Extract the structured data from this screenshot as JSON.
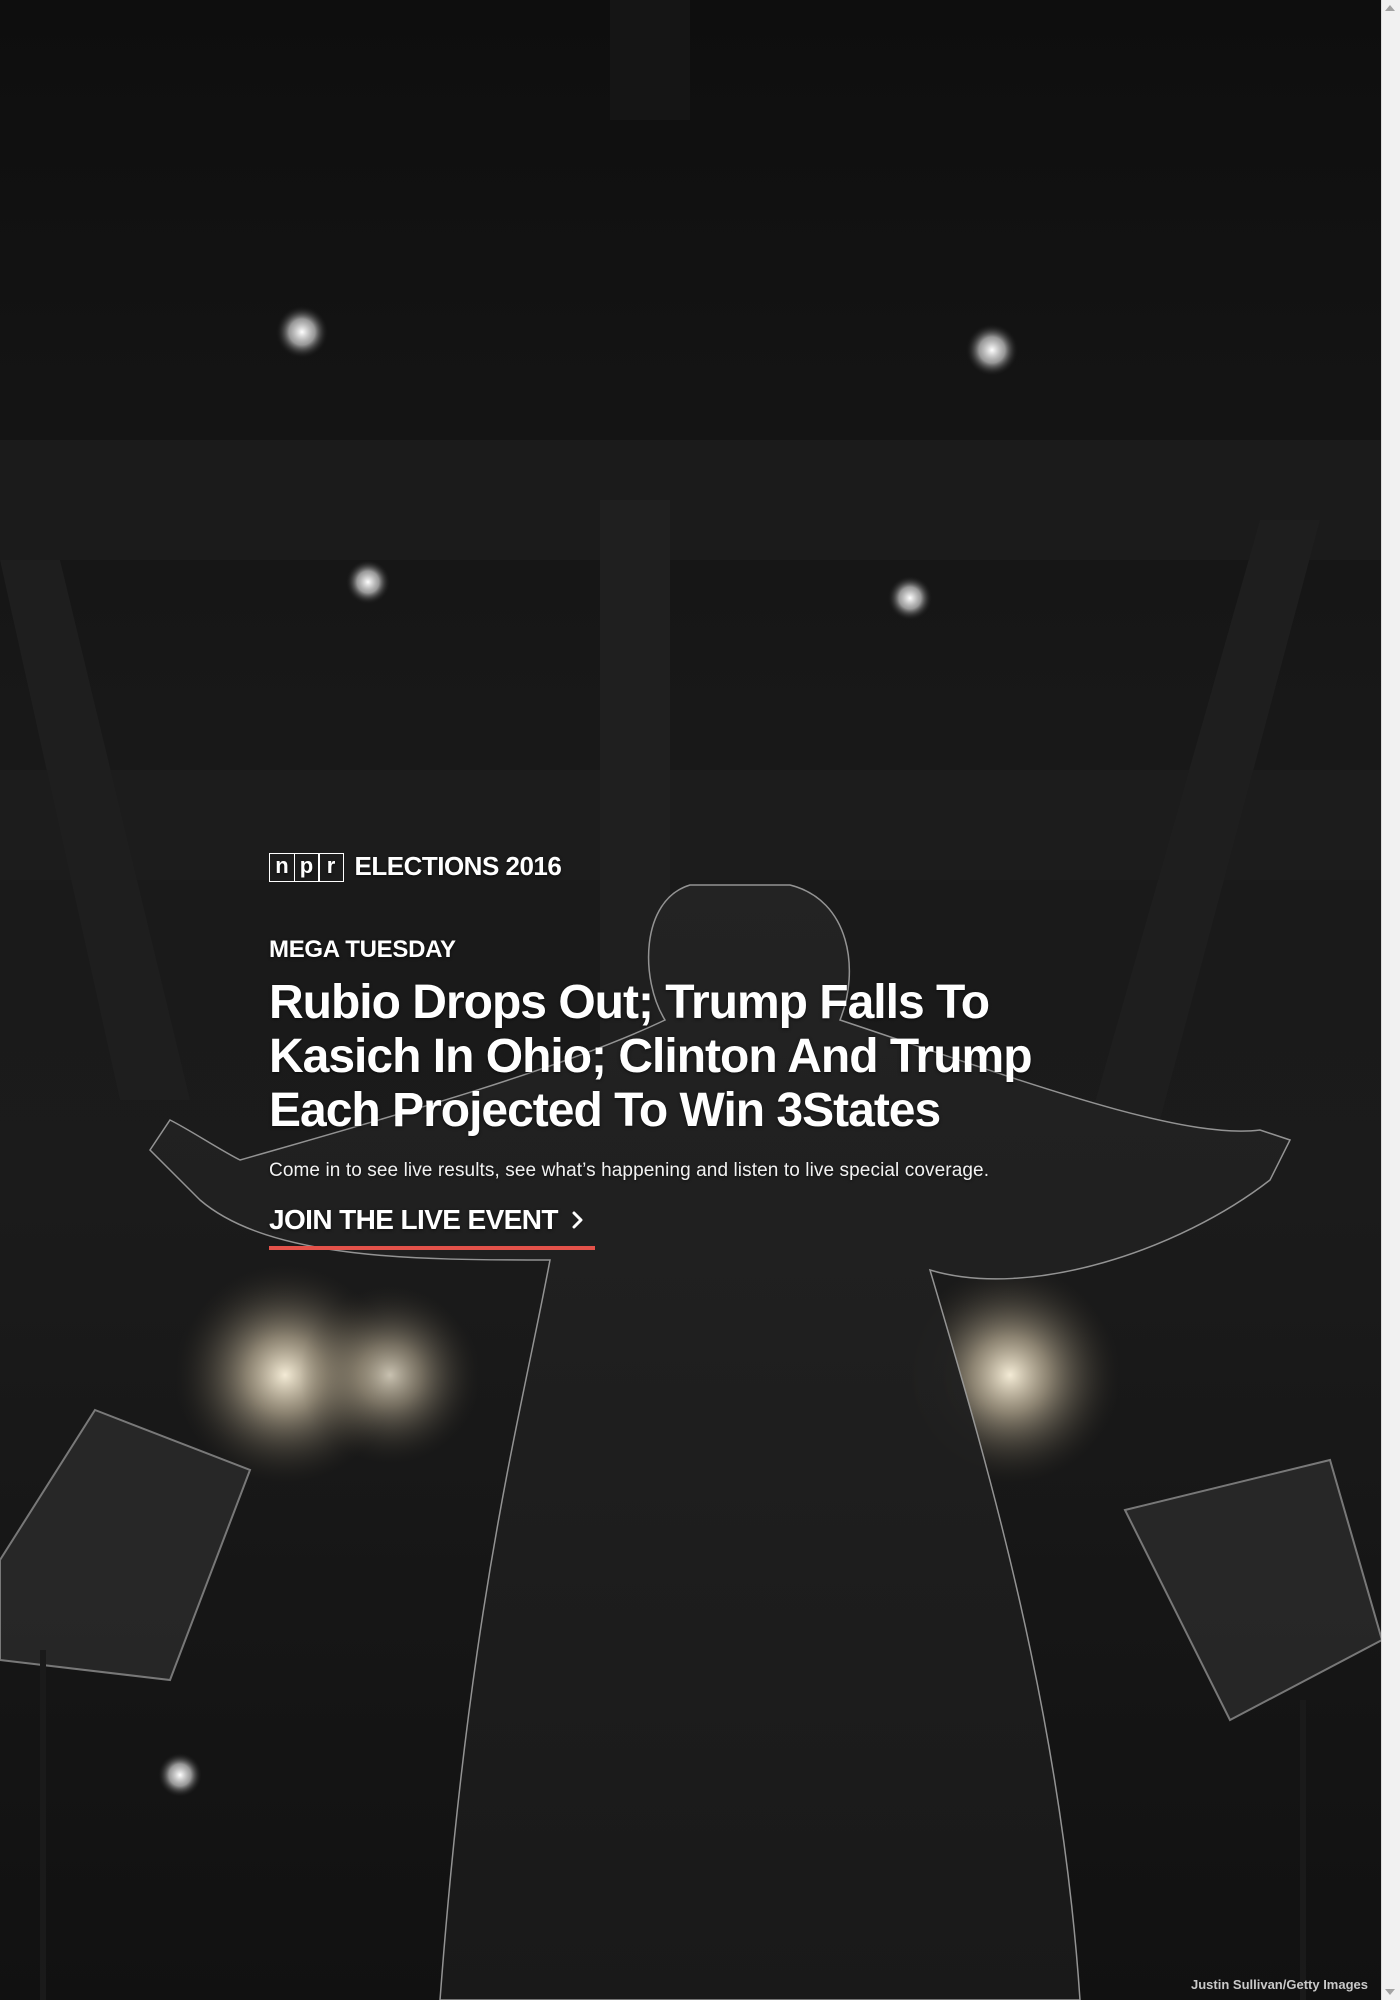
{
  "brand": {
    "logo_letters": [
      "n",
      "p",
      "r"
    ],
    "section": "ELECTIONS 2016"
  },
  "story": {
    "kicker": "MEGA TUESDAY",
    "headline": "Rubio Drops Out; Trump Falls To Kasich In Ohio; Clinton And Trump Each Projected To Win 3States",
    "teaser": "Come in to see live results, see what’s happening and listen to live special coverage.",
    "cta_label": "JOIN THE LIVE EVENT"
  },
  "photo": {
    "credit": "Justin Sullivan/Getty Images"
  },
  "colors": {
    "accent": "#e4524a",
    "text": "#ffffff",
    "background": "#111111"
  },
  "icons": {
    "cta": "chevron-right-icon"
  }
}
